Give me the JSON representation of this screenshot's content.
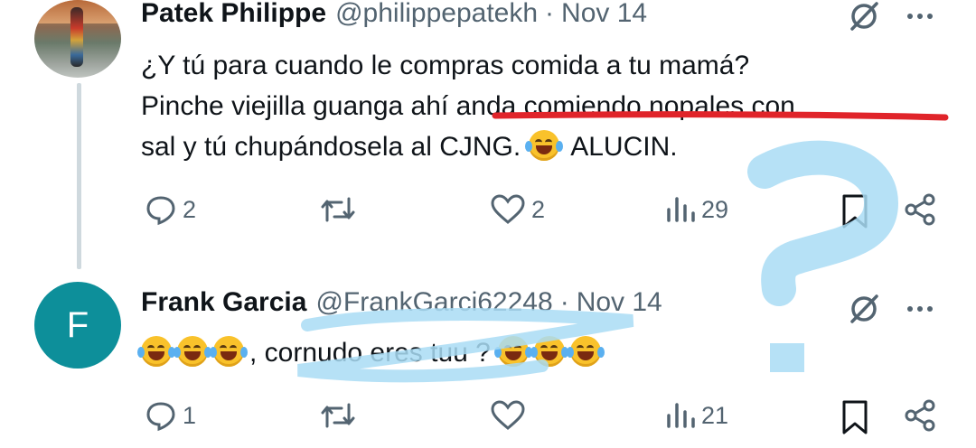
{
  "tweets": [
    {
      "name": "Patek Philippe",
      "handle": "@philippepatekh",
      "separator": "·",
      "date": "Nov 14",
      "text_line1": "¿Y tú para cuando le compras comida a tu mamá?",
      "text_line2": "Pinche viejilla guanga ahí anda comiendo nopales con",
      "text_line3a": "sal y tú chupándosela al CJNG. ",
      "text_line3b": " ALUCIN.",
      "actions": {
        "replies": "2",
        "reposts": "",
        "likes": "2",
        "views": "29"
      },
      "icons": [
        "grok-icon",
        "more-icon",
        "reply-icon",
        "repost-icon",
        "like-icon",
        "views-icon",
        "bookmark-icon",
        "share-icon"
      ]
    },
    {
      "name": "Frank Garcia",
      "handle": "@FrankGarci62248",
      "separator": "·",
      "date": "Nov 14",
      "avatar_letter": "F",
      "text_middle": ", cornudo eres tuu ? ",
      "actions": {
        "replies": "1",
        "reposts": "",
        "likes": "",
        "views": "21"
      }
    }
  ],
  "colors": {
    "text": "#0f1419",
    "secondary": "#536471",
    "thread_line": "#cfd9de",
    "avatar_bg": "#0d8f9a",
    "red_underline": "#e0242a",
    "blue_annotation": "#a9dcf5"
  }
}
